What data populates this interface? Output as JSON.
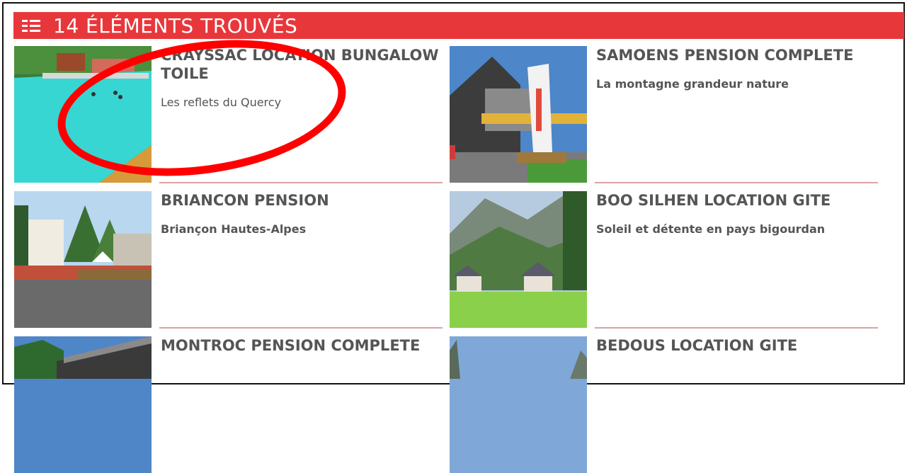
{
  "header": {
    "title": "14 ÉLÉMENTS TROUVÉS",
    "accent": "#e8373b",
    "icon": "grid-list-icon"
  },
  "results": [
    {
      "title": "CRAYSSAC LOCATION BUNGALOW TOILE",
      "subtitle": "Les reflets du Quercy",
      "image": "pool-icon"
    },
    {
      "title": "SAMOENS PENSION COMPLETE",
      "subtitle": "La montagne grandeur nature",
      "image": "chalet-terrace-icon"
    },
    {
      "title": "BRIANCON PENSION",
      "subtitle": "Briançon Hautes-Alpes",
      "image": "hotel-park-icon"
    },
    {
      "title": "BOO SILHEN LOCATION GITE",
      "subtitle": "Soleil et détente en pays bigourdan",
      "image": "mountain-cottages-icon"
    },
    {
      "title": "MONTROC PENSION COMPLETE",
      "subtitle": "",
      "image": "mountain-roof-icon"
    },
    {
      "title": "BEDOUS LOCATION GITE",
      "subtitle": "",
      "image": "sky-mountain-icon"
    }
  ],
  "annotation": {
    "color": "#ff0000"
  }
}
